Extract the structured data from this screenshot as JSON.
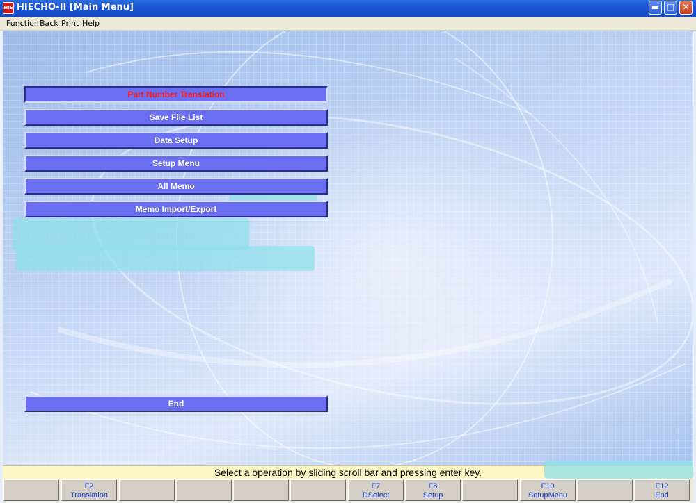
{
  "window": {
    "title": "HIECHO-II [Main Menu]",
    "icon_text": "HIE",
    "controls": [
      "minimize",
      "maximize",
      "close"
    ]
  },
  "menubar": {
    "items": [
      "Function",
      "Back",
      "Print",
      "Help"
    ]
  },
  "main_menu": {
    "buttons": [
      {
        "label": "Part Number Translation",
        "selected": true
      },
      {
        "label": "Save File List",
        "selected": false
      },
      {
        "label": "Data Setup",
        "selected": false
      },
      {
        "label": "Setup Menu",
        "selected": false
      },
      {
        "label": "All Memo",
        "selected": false
      },
      {
        "label": "Memo Import/Export",
        "selected": false
      }
    ],
    "end_button": "End"
  },
  "status_bar": {
    "message": "Select a operation by sliding scroll bar and pressing enter key."
  },
  "function_keys": [
    {
      "key": "",
      "label": ""
    },
    {
      "key": "F2",
      "label": "Translation"
    },
    {
      "key": "",
      "label": ""
    },
    {
      "key": "",
      "label": ""
    },
    {
      "key": "",
      "label": ""
    },
    {
      "key": "",
      "label": ""
    },
    {
      "key": "F7",
      "label": "DSelect"
    },
    {
      "key": "F8",
      "label": "Setup"
    },
    {
      "key": "",
      "label": ""
    },
    {
      "key": "F10",
      "label": "SetupMenu"
    },
    {
      "key": "",
      "label": ""
    },
    {
      "key": "F12",
      "label": "End"
    }
  ],
  "colors": {
    "button_bg": "#6a6ef0",
    "selected_text": "#ff1a1a",
    "fkey_text": "#1a3cc8",
    "status_bg": "#fbf6c4"
  }
}
